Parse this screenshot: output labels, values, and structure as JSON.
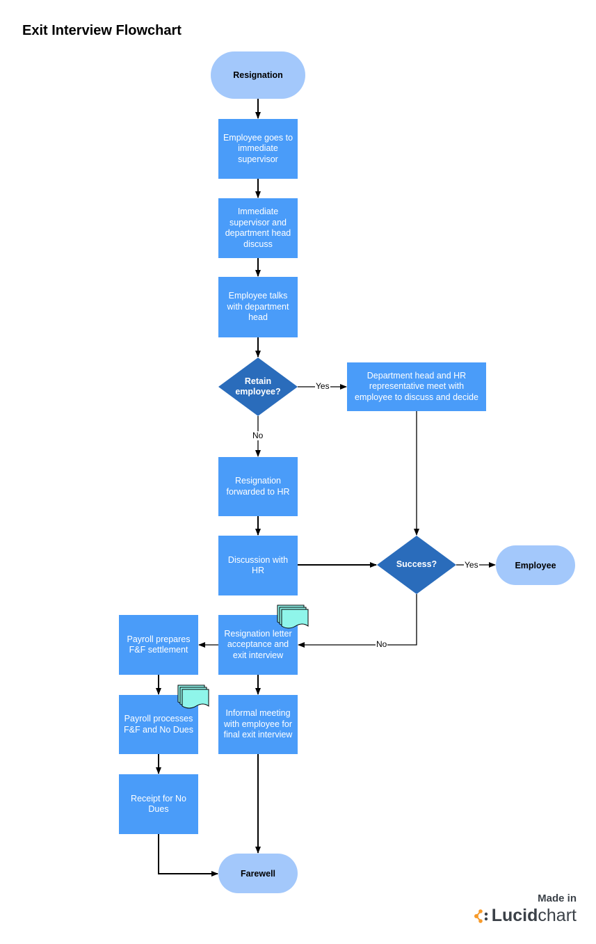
{
  "title": "Exit Interview Flowchart",
  "colors": {
    "process": "#4a9cf9",
    "terminal": "#a3c8fb",
    "decision": "#2a6cbb",
    "document": "#8ff5ea",
    "connector": "#000000",
    "brand_orange": "#f79a2a"
  },
  "nodes": {
    "resignation": "Resignation",
    "goes_to_supervisor": "Employee goes to immediate supervisor",
    "supervisor_dept_discuss": "Immediate supervisor and department head discuss",
    "talks_dept_head": "Employee talks with department head",
    "retain_decision": "Retain employee?",
    "dept_hr_meet": "Department head and HR representative meet with employee to discuss and decide",
    "forwarded_hr": "Resignation forwarded to HR",
    "discussion_hr": "Discussion with HR",
    "success_decision": "Success?",
    "employee": "Employee",
    "letter_acceptance": "Resignation letter acceptance and exit interview",
    "payroll_prepares": "Payroll prepares F&F settlement",
    "payroll_processes": "Payroll processes F&F and No Dues",
    "informal_meeting": "Informal meeting with employee for final exit interview",
    "receipt_no_dues": "Receipt for No Dues",
    "farewell": "Farewell"
  },
  "edge_labels": {
    "retain_yes": "Yes",
    "retain_no": "No",
    "success_yes": "Yes",
    "success_no": "No"
  },
  "edges": [
    {
      "from": "resignation",
      "to": "goes_to_supervisor"
    },
    {
      "from": "goes_to_supervisor",
      "to": "supervisor_dept_discuss"
    },
    {
      "from": "supervisor_dept_discuss",
      "to": "talks_dept_head"
    },
    {
      "from": "talks_dept_head",
      "to": "retain_decision"
    },
    {
      "from": "retain_decision",
      "to": "dept_hr_meet",
      "label": "Yes"
    },
    {
      "from": "retain_decision",
      "to": "forwarded_hr",
      "label": "No"
    },
    {
      "from": "forwarded_hr",
      "to": "discussion_hr"
    },
    {
      "from": "discussion_hr",
      "to": "success_decision"
    },
    {
      "from": "dept_hr_meet",
      "to": "success_decision"
    },
    {
      "from": "success_decision",
      "to": "employee",
      "label": "Yes"
    },
    {
      "from": "success_decision",
      "to": "letter_acceptance",
      "label": "No"
    },
    {
      "from": "letter_acceptance",
      "to": "payroll_prepares"
    },
    {
      "from": "letter_acceptance",
      "to": "informal_meeting"
    },
    {
      "from": "payroll_prepares",
      "to": "payroll_processes"
    },
    {
      "from": "payroll_processes",
      "to": "receipt_no_dues"
    },
    {
      "from": "receipt_no_dues",
      "to": "farewell"
    },
    {
      "from": "informal_meeting",
      "to": "farewell"
    }
  ],
  "branding": {
    "made_in": "Made in",
    "lucid": "Lucid",
    "chart": "chart"
  }
}
